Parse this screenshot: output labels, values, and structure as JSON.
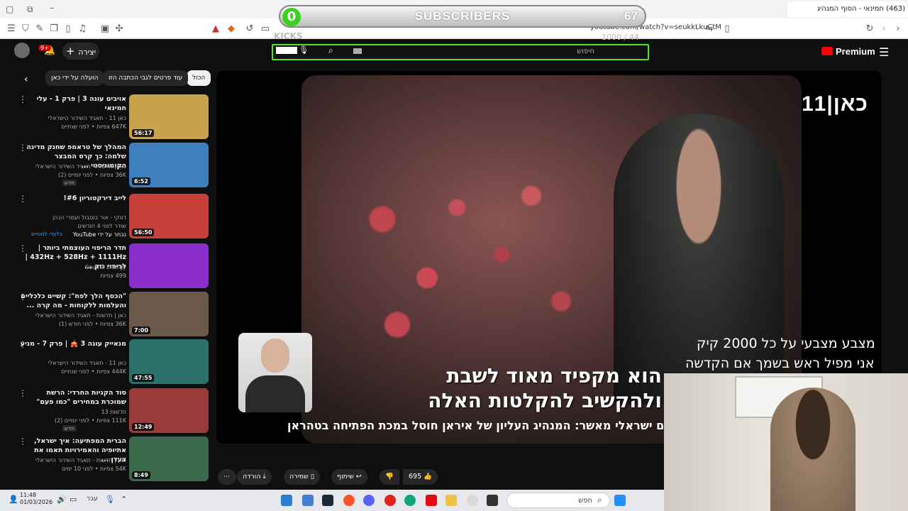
{
  "subscriber_overlay": {
    "current": "0",
    "label": "SUBSCRIBERS",
    "goal": "67"
  },
  "kicks_overlay": {
    "label": "KICKS",
    "goal_text": "1000 / 44"
  },
  "browser": {
    "active_tab_title": "(463) חמינאי - הסוף המנהיג",
    "url": "youtube.com/watch?v=seukkLkuCtM"
  },
  "youtube": {
    "search_placeholder": "חיפוש",
    "premium_label": "Premium",
    "create_label": "יצירה",
    "notification_count": "9+",
    "chips": [
      "הכול",
      "עוד פרטים לגבי הכתבה הזו",
      "הועלה על ידי כאן"
    ]
  },
  "recommendations": [
    {
      "title": "אויבים עונה 3 | פרק 1 - עלי חמינאי",
      "channel": "כאן 11 - תאגיד השידור הישראלי",
      "meta": "647K צפיות • לפני שנתיים",
      "duration": "56:17",
      "thumb_color": "#c9a24a"
    },
    {
      "title": "המהלך של טראמפ שחנק מדינה שלמה: כך קרס המבצר הקומוניסטי ...",
      "channel": "כאן | חדשות - תאגיד השידור הישראלי",
      "meta": "36K צפיות • לפני יומיים (2)",
      "badge": "חדש",
      "duration": "6:52",
      "thumb_color": "#3d7fbf"
    },
    {
      "title": "לייב דירקטוריון #6!",
      "channel": "דונקי - אור בוטבול ועמרי הכהן",
      "meta": "שודר לפני 4 חודשים",
      "extra": "נבחר על ידי YouTube",
      "member": "בלעדי למנויים",
      "duration": "56:50",
      "thumb_color": "#c8403a"
    },
    {
      "title": "תדר הריפוי העוצמתי ביותר | 432Hz + 528Hz + 1111Hz | לריפוי נזק ...",
      "channel": "Soulful Energy",
      "meta": "499 צפיות",
      "duration": "",
      "thumb_color": "#8a2ec9"
    },
    {
      "title": "\"הכסף הלך לפח\": קשיים כלכליים והעלמות ללקוחות - מה קרה ...",
      "channel": "כאן | חדשות - תאגיד השידור הישראלי",
      "meta": "36K צפיות • לפני חודש (1)",
      "duration": "7:00",
      "thumb_color": "#6b5a4a"
    },
    {
      "title": "מנאייק עונה 3 🎪 | פרק 7 - מניע",
      "channel": "כאן 11 - תאגיד השידור הישראלי",
      "meta": "444K צפיות • לפני שנתיים",
      "duration": "47:55",
      "thumb_color": "#2d6f6a"
    },
    {
      "title": "סוד הקניות החרדי: הרשת שמוכרת במחירים \"כמו פעם\"",
      "channel": "חדשות 13",
      "meta": "111K צפיות • לפני יומיים (2)",
      "badge": "חדש",
      "duration": "12:49",
      "thumb_color": "#9a3a3a"
    },
    {
      "title": "הברית המפתיעה: איך ישראל, אתיופיה והאמירויות תאמו את צעדן ...",
      "channel": "כאן | חדשות - תאגיד השידור הישראלי",
      "meta": "54K צפיות • לפני 10 ימים",
      "duration": "8:49",
      "thumb_color": "#3a6a4a"
    }
  ],
  "player": {
    "channel_logo": "כאן|11",
    "subtitle_line1": "הוא מקפיד מאוד לשבת",
    "subtitle_line2": "ולהקשיב להקלטות האלה",
    "ticker": "רם ישראלי מאשר: המנהיג העליון של איראן חוסל במכת הפתיחה בטהראן"
  },
  "actions": {
    "likes": "695",
    "share": "שיתוף",
    "save": "שמירה",
    "download": "הורדה"
  },
  "stream_overlay": {
    "line1": "מצבע מצבעי על כל 2000 קיק",
    "line2": "אני  מפיל ראש בשמך  אם הקדשה"
  },
  "taskbar": {
    "time": "11:48",
    "date": "01/03/2026",
    "search": "חפש",
    "lang": "עבר"
  }
}
